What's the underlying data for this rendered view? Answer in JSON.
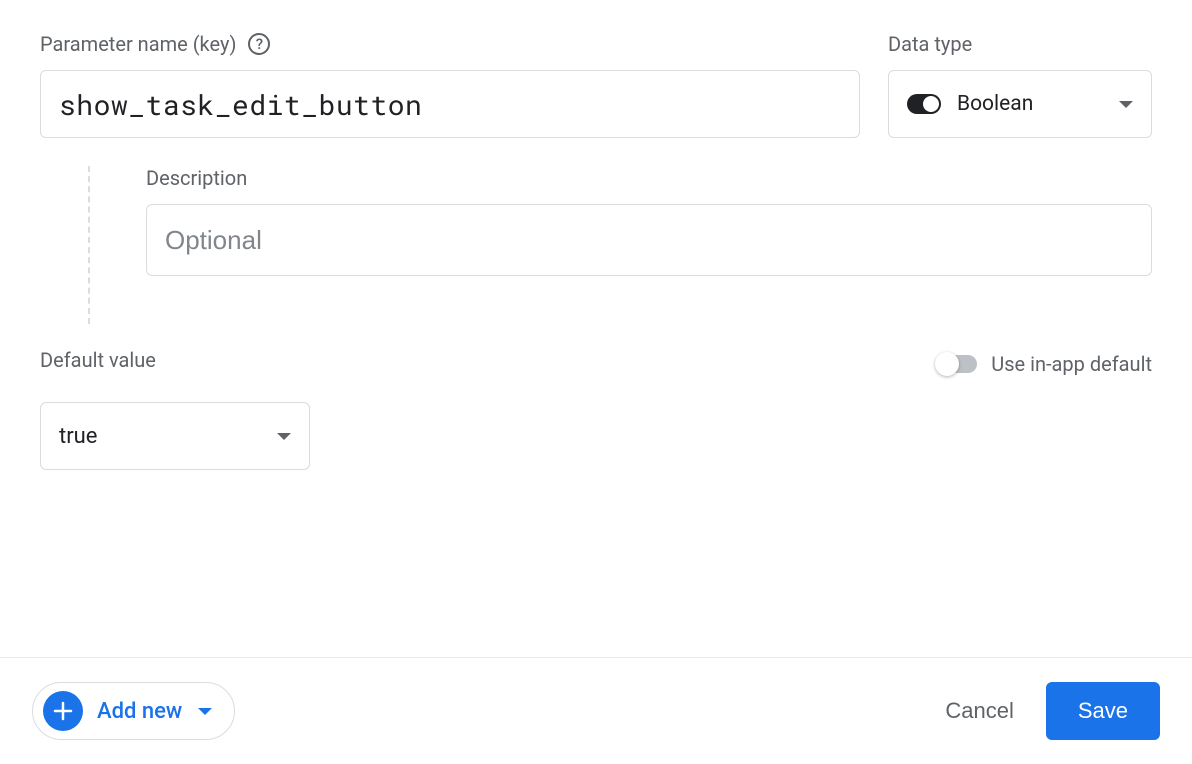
{
  "labels": {
    "parameter_name": "Parameter name (key)",
    "data_type": "Data type",
    "description": "Description",
    "default_value": "Default value",
    "use_in_app_default": "Use in-app default"
  },
  "values": {
    "parameter_name": "show_task_edit_button",
    "data_type": "Boolean",
    "description": "",
    "description_placeholder": "Optional",
    "default_value": "true",
    "use_in_app_default": false
  },
  "footer": {
    "add_new": "Add new",
    "cancel": "Cancel",
    "save": "Save"
  }
}
